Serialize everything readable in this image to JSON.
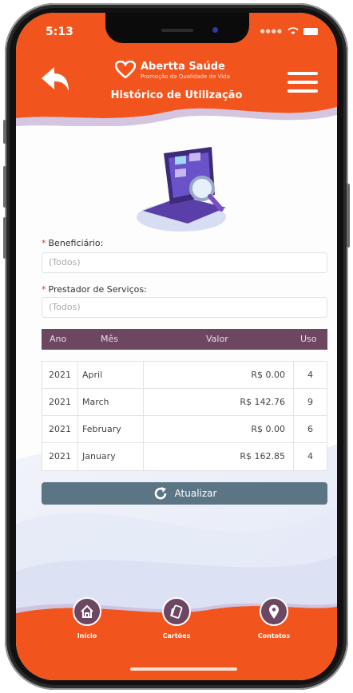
{
  "status": {
    "time": "5:13"
  },
  "app": {
    "brand_name": "Abertta Saúde",
    "brand_tagline": "Promoção da Qualidade de Vida",
    "page_title": "Histórico de Utilização"
  },
  "form": {
    "beneficiario": {
      "label": "Beneficiário:",
      "placeholder": "(Todos)",
      "required_mark": "*"
    },
    "prestador": {
      "label": "Prestador de Serviços:",
      "placeholder": "(Todos)",
      "required_mark": "*"
    }
  },
  "table": {
    "headers": {
      "ano": "Ano",
      "mes": "Mês",
      "valor": "Valor",
      "uso": "Uso"
    },
    "rows": [
      {
        "ano": "2021",
        "mes": "April",
        "valor": "R$ 0.00",
        "uso": "4"
      },
      {
        "ano": "2021",
        "mes": "March",
        "valor": "R$ 142.76",
        "uso": "9"
      },
      {
        "ano": "2021",
        "mes": "February",
        "valor": "R$ 0.00",
        "uso": "6"
      },
      {
        "ano": "2021",
        "mes": "January",
        "valor": "R$ 162.85",
        "uso": "4"
      }
    ]
  },
  "actions": {
    "refresh_label": "Atualizar"
  },
  "nav": {
    "home": "Início",
    "cards": "Cartões",
    "contacts": "Contatos"
  },
  "colors": {
    "primary_orange": "#f2541d",
    "purple": "#6d4762",
    "slate": "#5b7585"
  }
}
